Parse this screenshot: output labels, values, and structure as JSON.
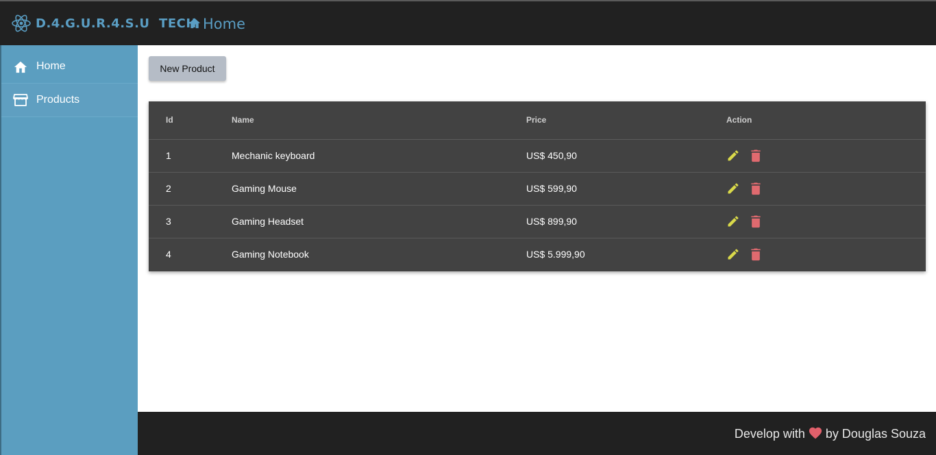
{
  "header": {
    "brand": "D.4.G.U.R.4.S.U  TECH",
    "breadcrumb": "Home",
    "brand_color": "#5a9ec4",
    "background": "#212121"
  },
  "sidebar": {
    "background": "#5b9ec0",
    "items": [
      {
        "label": "Home",
        "icon": "home-icon"
      },
      {
        "label": "Products",
        "icon": "store-icon"
      }
    ]
  },
  "main": {
    "new_button_label": "New Product",
    "table": {
      "headers": [
        "Id",
        "Name",
        "Price",
        "Action"
      ],
      "rows": [
        {
          "id": "1",
          "name": "Mechanic keyboard",
          "price": "US$ 450,90"
        },
        {
          "id": "2",
          "name": "Gaming Mouse",
          "price": "US$ 599,90"
        },
        {
          "id": "3",
          "name": "Gaming Headset",
          "price": "US$ 899,90"
        },
        {
          "id": "4",
          "name": "Gaming Notebook",
          "price": "US$ 5.999,90"
        }
      ],
      "action_icons": [
        "pencil-icon",
        "trash-icon"
      ],
      "edit_color": "#d9d94a",
      "delete_color": "#e06a6f"
    }
  },
  "footer": {
    "prefix": "Develop with",
    "suffix": "by Douglas Souza",
    "heart_color": "#e0606b"
  }
}
